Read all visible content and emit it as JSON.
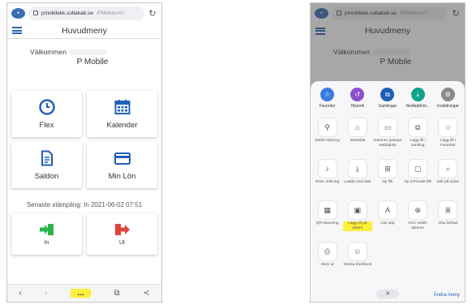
{
  "url": {
    "host": "pmobilekk.soltakab.se",
    "path": "/PMobile/#/!"
  },
  "app": {
    "title": "Huvudmeny",
    "welcome": "Välkommen",
    "username": "P Mobile"
  },
  "tiles": [
    {
      "label": "Flex",
      "icon": "clock-icon"
    },
    {
      "label": "Kalender",
      "icon": "calendar-icon"
    },
    {
      "label": "Saldon",
      "icon": "document-icon"
    },
    {
      "label": "Min Lön",
      "icon": "card-icon"
    }
  ],
  "last_stamp": "Senaste stämpling: In 2021-06-02 07:51",
  "stamp": {
    "in_label": "In",
    "out_label": "Ut"
  },
  "bottom": {
    "back": "‹",
    "forward": "›",
    "more": "...",
    "tabs": "⧉",
    "share": "≺"
  },
  "sheet": {
    "top": [
      {
        "label": "Favoriter",
        "color": "#3a7be0"
      },
      {
        "label": "Historik",
        "color": "#8a4fd0"
      },
      {
        "label": "Samlingar",
        "color": "#1f5fb8"
      },
      {
        "label": "Nedladdnin...",
        "color": "#13a38a"
      },
      {
        "label": "Inställningar",
        "color": "#8a8a8a"
      }
    ],
    "grid": [
      {
        "label": "Webb-sökning",
        "glyph": "⚲"
      },
      {
        "label": "Startsida",
        "glyph": "⌂"
      },
      {
        "label": "Datoran passad webbplats",
        "glyph": "▭"
      },
      {
        "label": "Lägg till i samling",
        "glyph": "⧉"
      },
      {
        "label": "Lägg till i Favoriter",
        "glyph": "☆"
      },
      {
        "label": "Röst- sökning",
        "glyph": "♪"
      },
      {
        "label": "Ladda ned sida",
        "glyph": "⤓"
      },
      {
        "label": "Ny flik",
        "glyph": "⊞"
      },
      {
        "label": "Ny InPrivate-flik",
        "glyph": "▢"
      },
      {
        "label": "Sök på sidan",
        "glyph": "⌕"
      },
      {
        "label": "QR-skanning",
        "glyph": "▦"
      },
      {
        "label": "Lägg till på skärm",
        "glyph": "▣",
        "highlight": true
      },
      {
        "label": "Läs upp",
        "glyph": "A"
      },
      {
        "label": "Avsl. webb-läsaren",
        "glyph": "⊗"
      },
      {
        "label": "Visa lösfaxt",
        "glyph": "≣"
      },
      {
        "label": "Skriv ut",
        "glyph": "⎙"
      },
      {
        "label": "Skicka feedback",
        "glyph": "☺"
      }
    ],
    "close": "✕",
    "more_menu": "Ändra meny"
  }
}
